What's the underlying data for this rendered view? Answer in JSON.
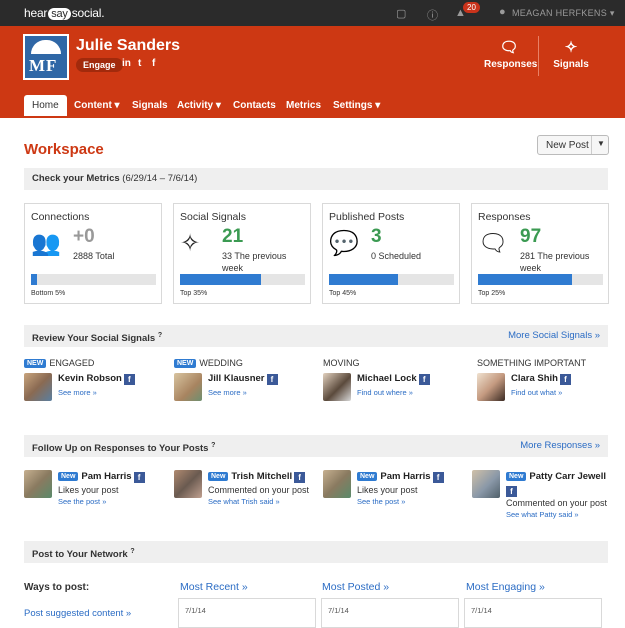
{
  "topbar": {
    "logo_pre": "hear",
    "logo_say": "say",
    "logo_post": "social.",
    "notif_count": "20",
    "user": "MEAGAN HERFKENS"
  },
  "profile": {
    "name": "Julie Sanders",
    "engage_label": "Engage",
    "avatar_text": "MF",
    "social": [
      "in",
      "t",
      "f"
    ]
  },
  "header_actions": {
    "responses": "Responses",
    "signals": "Signals"
  },
  "nav": [
    "Home",
    "Content ▾",
    "Signals",
    "Activity ▾",
    "Contacts",
    "Metrics",
    "Settings ▾"
  ],
  "page": {
    "title": "Workspace",
    "new_post": "New Post"
  },
  "metrics": {
    "heading": "Check your Metrics",
    "range": "(6/29/14 – 7/6/14)",
    "cards": [
      {
        "title": "Connections",
        "value": "+0",
        "sub": "2888 Total",
        "progress": 0.05,
        "foot": "Bottom 5%"
      },
      {
        "title": "Social Signals",
        "value": "21",
        "sub": "33 The previous week",
        "progress": 0.65,
        "foot": "Top 35%"
      },
      {
        "title": "Published Posts",
        "value": "3",
        "sub": "0 Scheduled",
        "progress": 0.55,
        "foot": "Top 45%"
      },
      {
        "title": "Responses",
        "value": "97",
        "sub": "281 The previous week",
        "progress": 0.75,
        "foot": "Top 25%"
      }
    ]
  },
  "signals": {
    "heading": "Review Your Social Signals",
    "more": "More Social Signals »",
    "new_label": "New",
    "items": [
      {
        "category": "ENGAGED",
        "new": true,
        "name": "Kevin Robson",
        "link": "See more »"
      },
      {
        "category": "WEDDING",
        "new": true,
        "name": "Jill Klausner",
        "link": "See more »"
      },
      {
        "category": "MOVING",
        "new": false,
        "name": "Michael Lock",
        "link": "Find out where »"
      },
      {
        "category": "SOMETHING IMPORTANT",
        "new": false,
        "name": "Clara Shih",
        "link": "Find out what »"
      }
    ]
  },
  "responses": {
    "heading": "Follow Up on Responses to Your Posts",
    "more": "More Responses »",
    "new_label": "New",
    "items": [
      {
        "name": "Pam Harris",
        "action": "Likes your post",
        "link": "See the post »"
      },
      {
        "name": "Trish Mitchell",
        "action": "Commented on your post",
        "link": "See what Trish said »"
      },
      {
        "name": "Pam Harris",
        "action": "Likes your post",
        "link": "See the post »"
      },
      {
        "name": "Patty Carr Jewell",
        "action": "Commented on your post",
        "link": "See what Patty said »"
      }
    ]
  },
  "post": {
    "heading": "Post to Your Network",
    "ways": "Ways to post:",
    "suggested": "Post suggested content »",
    "columns": [
      {
        "title": "Most Recent »",
        "date": "7/1/14"
      },
      {
        "title": "Most Posted »",
        "date": "7/1/14"
      },
      {
        "title": "Most Engaging »",
        "date": "7/1/14"
      }
    ]
  }
}
